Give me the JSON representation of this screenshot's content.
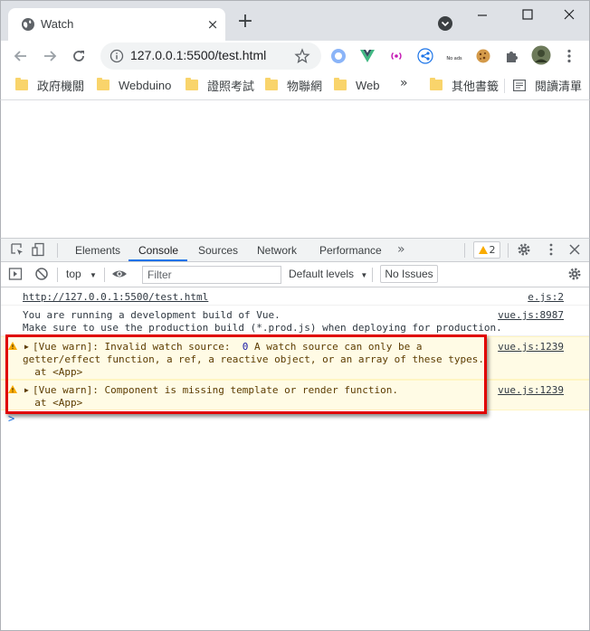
{
  "browser": {
    "tab": {
      "title": "Watch",
      "close": "×"
    },
    "new_tab": "+",
    "address": {
      "url": "127.0.0.1:5500/test.html"
    },
    "extensions": [
      {
        "name": "shield-extension-icon"
      },
      {
        "name": "vue-devtools-icon",
        "color": "#41b883"
      },
      {
        "name": "radio-extension-icon"
      },
      {
        "name": "share-extension-icon"
      },
      {
        "name": "noads-extension-icon",
        "label": "No ads"
      },
      {
        "name": "cookie-extension-icon"
      },
      {
        "name": "puzzle-extensions-icon"
      },
      {
        "name": "profile-avatar"
      },
      {
        "name": "kebab-menu-icon"
      }
    ],
    "bookmarks": [
      {
        "label": "政府機關"
      },
      {
        "label": "Webduino"
      },
      {
        "label": "證照考試"
      },
      {
        "label": "物聯網"
      },
      {
        "label": "Web"
      }
    ],
    "bookmarks_more": "»",
    "bookmarks_other": "其他書籤",
    "reading_list": "閱讀清單"
  },
  "devtools": {
    "tabs": [
      {
        "label": "Elements"
      },
      {
        "label": "Console",
        "active": true
      },
      {
        "label": "Sources"
      },
      {
        "label": "Network"
      },
      {
        "label": "Performance"
      }
    ],
    "more_tabs": "»",
    "warning_count": "2",
    "context": "top",
    "filter_placeholder": "Filter",
    "levels": "Default levels",
    "no_issues": "No Issues",
    "accent": "#1a73e8",
    "console": {
      "url_line": {
        "text": "http://127.0.0.1:5500/test.html",
        "source": "e.js:2"
      },
      "info": {
        "line1": "You are running a development build of Vue.",
        "line2": "Make sure to use the production build (*.prod.js) when deploying for production.",
        "source": "vue.js:8987"
      },
      "warn1": {
        "line1a": "[Vue warn]: Invalid watch source:  ",
        "value": "0",
        "line1b": " A watch source can only be a",
        "line2": "getter/effect function, a ref, a reactive object, or an array of these types.",
        "line3": "  at <App>",
        "source": "vue.js:1239"
      },
      "warn2": {
        "line1": "[Vue warn]: Component is missing template or render function.",
        "line2": "  at <App>",
        "source": "vue.js:1239"
      },
      "prompt": ">"
    },
    "highlight_color": "#e00000"
  }
}
